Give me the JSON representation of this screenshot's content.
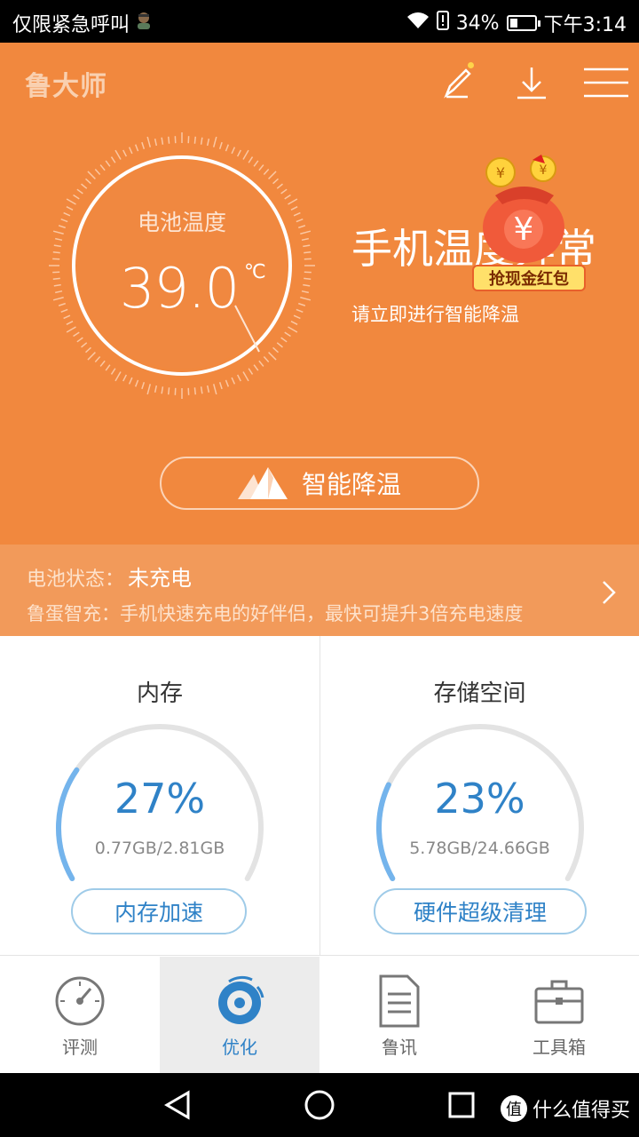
{
  "status_bar": {
    "left_text": "仅限紧急呼叫",
    "battery_percent": "34%",
    "battery_level": 0.34,
    "time": "下午3:14"
  },
  "header": {
    "logo": "鲁大师",
    "icons": [
      "edit-icon",
      "download-icon",
      "menu-icon"
    ]
  },
  "battery_gauge": {
    "label": "电池温度",
    "value": "39.0",
    "unit": "℃"
  },
  "warning": {
    "title": "手机温度异常",
    "subtitle": "请立即进行智能降温"
  },
  "promo": {
    "label": "抢现金红包"
  },
  "cool_button": {
    "label": "智能降温"
  },
  "battery_status": {
    "label": "电池状态：",
    "value": "未充电",
    "promo_text": "鲁蛋智充：手机快速充电的好伴侣，最快可提升3倍充电速度"
  },
  "cards": [
    {
      "title": "内存",
      "percent_text": "27%",
      "percent": 27,
      "usage": "0.77GB/2.81GB",
      "button": "内存加速"
    },
    {
      "title": "存储空间",
      "percent_text": "23%",
      "percent": 23,
      "usage": "5.78GB/24.66GB",
      "button": "硬件超级清理"
    }
  ],
  "bottom_nav": [
    {
      "label": "评测",
      "icon": "speedometer-icon",
      "active": false
    },
    {
      "label": "优化",
      "icon": "optimize-disc-icon",
      "active": true
    },
    {
      "label": "鲁讯",
      "icon": "document-icon",
      "active": false
    },
    {
      "label": "工具箱",
      "icon": "toolbox-icon",
      "active": false
    }
  ],
  "watermark": {
    "badge": "值",
    "text": "什么值得买"
  },
  "colors": {
    "orange": "#f1883e",
    "blue_accent": "#2f82c7",
    "light_blue": "#9fcbe8"
  }
}
